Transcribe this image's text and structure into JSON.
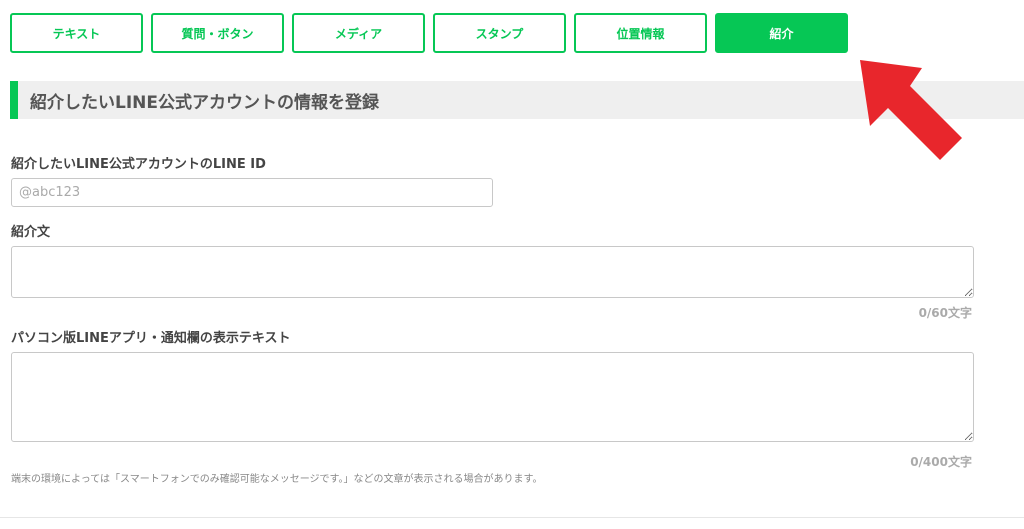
{
  "tabs": [
    {
      "label": "テキスト"
    },
    {
      "label": "質問・ボタン"
    },
    {
      "label": "メディア"
    },
    {
      "label": "スタンプ"
    },
    {
      "label": "位置情報"
    },
    {
      "label": "紹介"
    }
  ],
  "active_tab": "紹介",
  "section": {
    "title": "紹介したいLINE公式アカウントの情報を登録"
  },
  "line_id": {
    "label": "紹介したいLINE公式アカウントのLINE ID",
    "placeholder": "@abc123"
  },
  "intro": {
    "label": "紹介文",
    "counter": "0/60文字"
  },
  "pc_text": {
    "label": "パソコン版LINEアプリ・通知欄の表示テキスト",
    "counter": "0/400文字"
  },
  "note": "端末の環境によっては「スマートフォンでのみ確認可能なメッセージです。」などの文章が表示される場合があります。",
  "colors": {
    "accent": "#06c755",
    "arrow": "#e8262c",
    "header_bg": "#efefef"
  },
  "icons": {
    "annotation": "red-arrow-icon"
  }
}
